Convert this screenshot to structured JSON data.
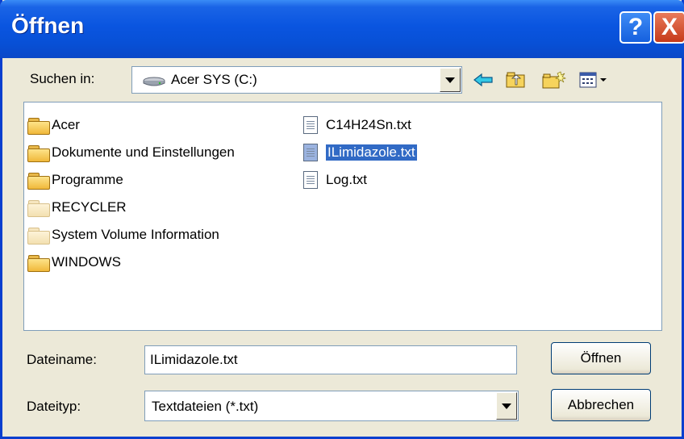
{
  "dialog": {
    "title": "Öffnen",
    "help_button": "?",
    "close_button": "X"
  },
  "look_in": {
    "label": "Suchen in:",
    "value": "Acer SYS (C:)",
    "icon": "hard-drive-icon"
  },
  "toolbar": {
    "icons": [
      "back-arrow-icon",
      "up-folder-icon",
      "new-folder-icon",
      "view-menu-icon"
    ]
  },
  "files": {
    "folders": [
      {
        "name": "Acer"
      },
      {
        "name": "Dokumente und Einstellungen"
      },
      {
        "name": "Programme"
      },
      {
        "name": "RECYCLER",
        "hidden": true
      },
      {
        "name": "System Volume Information",
        "hidden": true
      },
      {
        "name": "WINDOWS"
      }
    ],
    "documents": [
      {
        "name": "C14H24Sn.txt"
      },
      {
        "name": "ILimidazole.txt",
        "selected": true
      },
      {
        "name": "Log.txt"
      }
    ]
  },
  "filename": {
    "label": "Dateiname:",
    "value": "ILimidazole.txt"
  },
  "filetype": {
    "label": "Dateityp:",
    "value": "Textdateien (*.txt)"
  },
  "buttons": {
    "open": "Öffnen",
    "cancel": "Abbrechen"
  },
  "colors": {
    "titlebar": "#0a55e0",
    "selection": "#316ac5",
    "dialog_bg": "#ece9d8"
  }
}
